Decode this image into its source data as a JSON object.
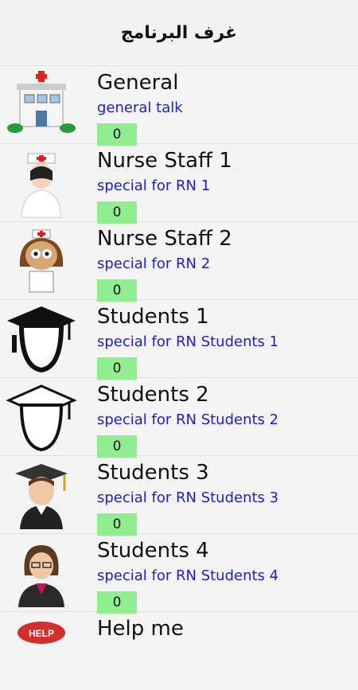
{
  "header": {
    "title": "غرف البرنامج"
  },
  "rooms": [
    {
      "title": "General",
      "subtitle": "general talk",
      "count": "0",
      "icon": "hospital-icon"
    },
    {
      "title": "Nurse Staff 1",
      "subtitle": "special for RN 1",
      "count": "0",
      "icon": "nurse-icon"
    },
    {
      "title": "Nurse Staff 2",
      "subtitle": "special for RN 2",
      "count": "0",
      "icon": "nurse-cartoon-icon"
    },
    {
      "title": "Students 1",
      "subtitle": "special for RN Students 1",
      "count": "0",
      "icon": "graduation-head-icon"
    },
    {
      "title": "Students 2",
      "subtitle": "special for RN Students 2",
      "count": "0",
      "icon": "graduation-outline-icon"
    },
    {
      "title": "Students 3",
      "subtitle": "special for RN Students 3",
      "count": "0",
      "icon": "graduate-icon"
    },
    {
      "title": "Students 4",
      "subtitle": "special for RN Students 4",
      "count": "0",
      "icon": "woman-icon"
    },
    {
      "title": "Help me",
      "subtitle": "",
      "count": "",
      "icon": "help-button-icon"
    }
  ],
  "colors": {
    "count_badge": "#90ee90",
    "subtitle": "#1e1ec8"
  }
}
